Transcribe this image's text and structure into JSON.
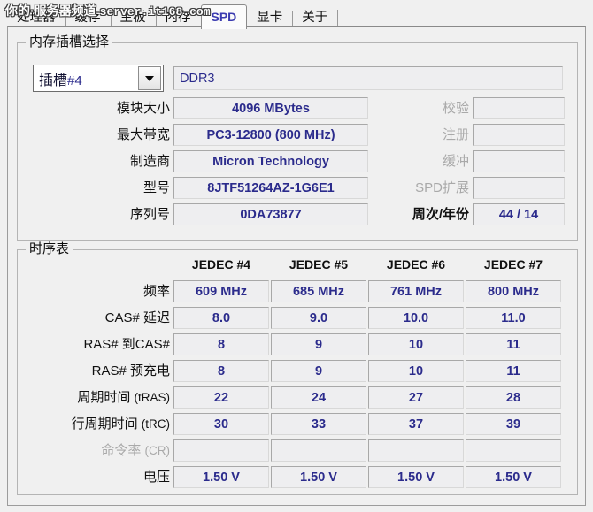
{
  "window": {
    "watermark_cn": "你的·服务器频道",
    "watermark_url": "server.it168.com"
  },
  "tabs": [
    {
      "id": "cpu",
      "label": "处理器",
      "selected": false
    },
    {
      "id": "cache",
      "label": "缓存",
      "selected": false
    },
    {
      "id": "mb",
      "label": "主板",
      "selected": false
    },
    {
      "id": "mem",
      "label": "内存",
      "selected": false
    },
    {
      "id": "spd",
      "label": "SPD",
      "selected": true
    },
    {
      "id": "gpu",
      "label": "显卡",
      "selected": false
    },
    {
      "id": "about",
      "label": "关于",
      "selected": false
    }
  ],
  "slot_group": {
    "legend": "内存插槽选择",
    "combo": {
      "prefix": "插槽",
      "value": "#4"
    },
    "module_type": "DDR3",
    "left_rows": [
      {
        "label": "模块大小",
        "value": "4096 MBytes",
        "dim": false
      },
      {
        "label": "最大带宽",
        "value": "PC3-12800 (800 MHz)",
        "dim": false
      },
      {
        "label": "制造商",
        "value": "Micron Technology",
        "dim": false
      },
      {
        "label": "型号",
        "value": "8JTF51264AZ-1G6E1",
        "dim": false
      },
      {
        "label": "序列号",
        "value": "0DA73877",
        "dim": false
      }
    ],
    "right_rows": [
      {
        "label": "校验",
        "value": "",
        "dim": true
      },
      {
        "label": "注册",
        "value": "",
        "dim": true
      },
      {
        "label": "缓冲",
        "value": "",
        "dim": true
      },
      {
        "label": "SPD扩展",
        "value": "",
        "dim": true
      },
      {
        "label": "周次/年份",
        "value": "44 / 14",
        "dim": false
      }
    ]
  },
  "timing_group": {
    "legend": "时序表",
    "columns": [
      "JEDEC #4",
      "JEDEC #5",
      "JEDEC #6",
      "JEDEC #7"
    ],
    "rows": [
      {
        "label": "频率",
        "sub": "",
        "dim": false,
        "values": [
          "609 MHz",
          "685 MHz",
          "761 MHz",
          "800 MHz"
        ]
      },
      {
        "label": "CAS# 延迟",
        "sub": "",
        "dim": false,
        "values": [
          "8.0",
          "9.0",
          "10.0",
          "11.0"
        ]
      },
      {
        "label": "RAS# 到CAS#",
        "sub": "",
        "dim": false,
        "values": [
          "8",
          "9",
          "10",
          "11"
        ]
      },
      {
        "label": "RAS# 预充电",
        "sub": "",
        "dim": false,
        "values": [
          "8",
          "9",
          "10",
          "11"
        ]
      },
      {
        "label": "周期时间",
        "sub": "(tRAS)",
        "dim": false,
        "values": [
          "22",
          "24",
          "27",
          "28"
        ]
      },
      {
        "label": "行周期时间",
        "sub": "(tRC)",
        "dim": false,
        "values": [
          "30",
          "33",
          "37",
          "39"
        ]
      },
      {
        "label": "命令率",
        "sub": "(CR)",
        "dim": true,
        "values": [
          "",
          "",
          "",
          ""
        ]
      },
      {
        "label": "电压",
        "sub": "",
        "dim": false,
        "values": [
          "1.50 V",
          "1.50 V",
          "1.50 V",
          "1.50 V"
        ]
      }
    ]
  },
  "colors": {
    "value_text": "#2b2b8c",
    "field_bg": "#eeeef0",
    "panel_bg": "#f0f0f0",
    "selected_tab_text": "#3b3bb0",
    "disabled_label": "#a9a9a9"
  }
}
